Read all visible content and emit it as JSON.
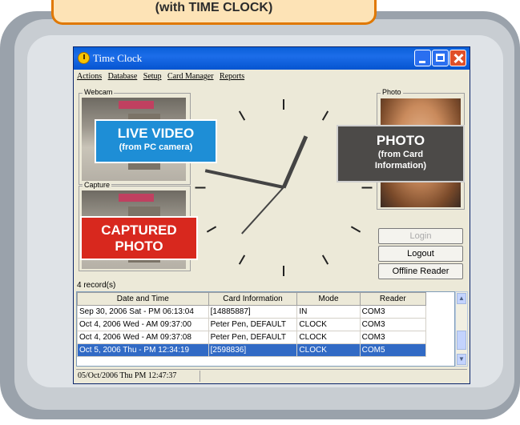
{
  "banner": {
    "text": "(with TIME CLOCK)"
  },
  "window": {
    "title": "Time Clock",
    "menu": [
      "Actions",
      "Database",
      "Setup",
      "Card Manager",
      "Reports"
    ]
  },
  "panels": {
    "webcam_label": "Webcam",
    "capture_label": "Capture",
    "photo_label": "Photo"
  },
  "buttons": {
    "login": "Login",
    "logout": "Logout",
    "offline_reader": "Offline Reader"
  },
  "records": {
    "count_label": "4 record(s)",
    "columns": [
      "Date and Time",
      "Card Information",
      "Mode",
      "Reader"
    ],
    "rows": [
      [
        "Sep 30, 2006 Sat - PM 06:13:04",
        "[14885887]",
        "IN",
        "COM3"
      ],
      [
        "Oct 4, 2006 Wed - AM 09:37:00",
        "Peter Pen, DEFAULT",
        "CLOCK",
        "COM3"
      ],
      [
        "Oct 4, 2006 Wed - AM 09:37:08",
        "Peter Pen, DEFAULT",
        "CLOCK",
        "COM3"
      ],
      [
        "Oct 5, 2006 Thu - PM 12:34:19",
        "[2598836]",
        "CLOCK",
        "COM5"
      ]
    ],
    "selected_row": 3
  },
  "status": {
    "text": "05/Oct/2006 Thu  PM 12:47:37"
  },
  "callouts": {
    "live_video": {
      "title": "LIVE VIDEO",
      "sub": "(from PC camera)"
    },
    "photo": {
      "title": "PHOTO",
      "sub1": "(from Card",
      "sub2": "Information)"
    },
    "captured": {
      "line1": "CAPTURED",
      "line2": "PHOTO"
    }
  },
  "colors": {
    "titlebar": "#0a5fd8",
    "selection": "#316ac5",
    "live_callout": "#1e8ed6",
    "photo_callout": "#4c4a48",
    "captured_callout": "#d8281e"
  },
  "clock": {
    "hour": 12,
    "minute": 47,
    "second": 37
  }
}
